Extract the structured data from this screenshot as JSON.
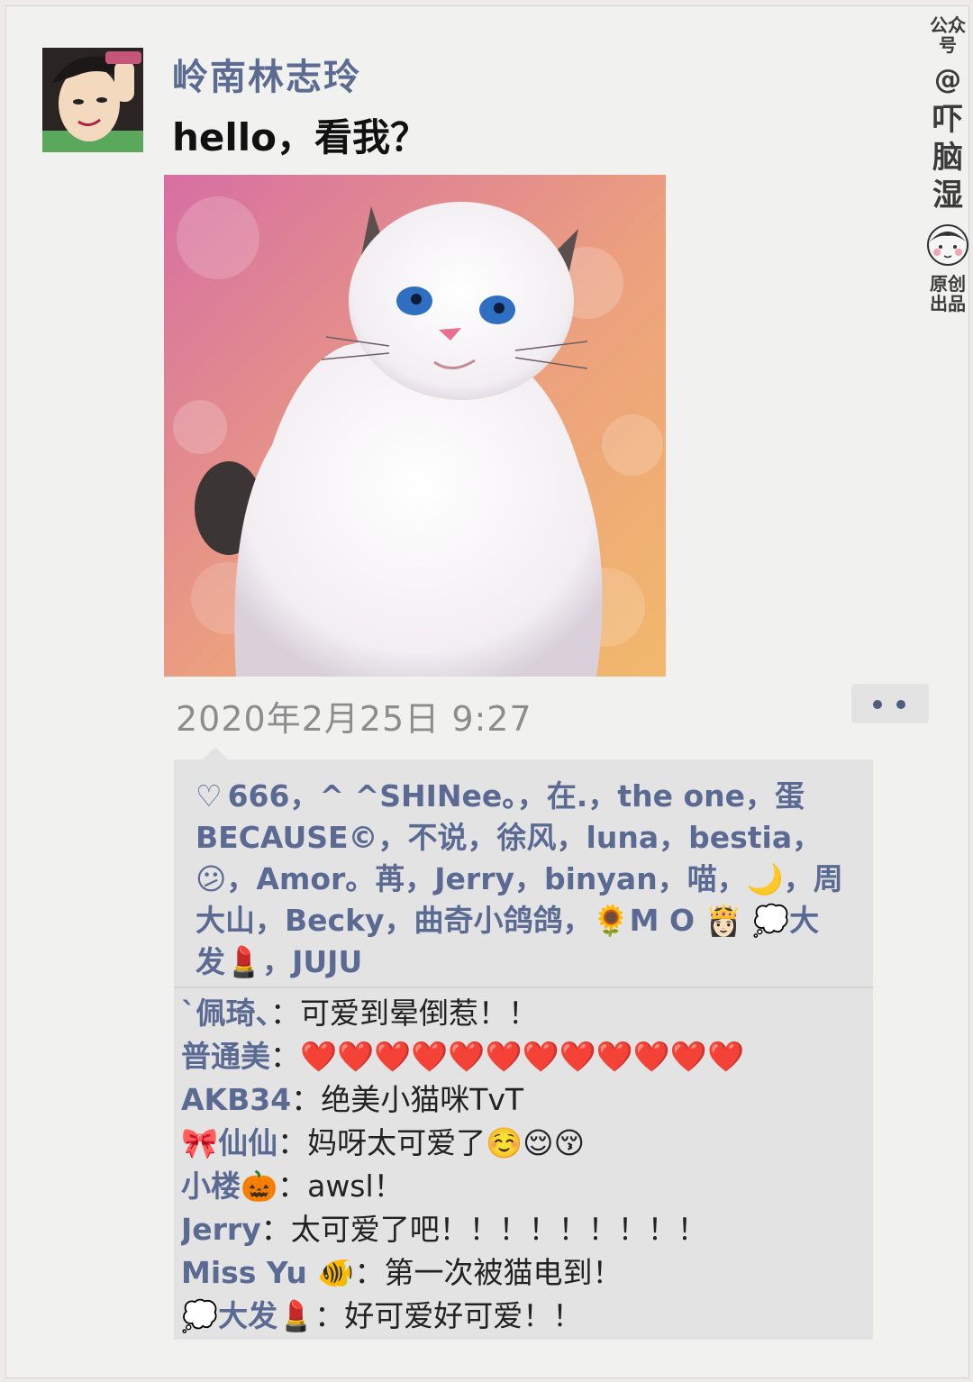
{
  "post": {
    "author": "岭南林志玲",
    "text": "hello，看我？",
    "timestamp": "2020年2月25日 9:27"
  },
  "likes": {
    "heart_icon": "heart-outline-icon",
    "text": "666，^ ^SHINee。，在.，the one，蛋BECAUSE©，不说，徐风，luna，bestia，😕，Amor。苒，Jerry，binyan，喵，🌙，周大山，Becky，曲奇小鸽鸽，🌻M O 👸🏻 💭大发💄，JUJU"
  },
  "comments": [
    {
      "name": "`佩琦、",
      "sep": "：",
      "text": "可爱到晕倒惹！！"
    },
    {
      "name": "普通美",
      "sep": "：",
      "text": "❤️❤️❤️❤️❤️❤️❤️❤️❤️❤️❤️❤️"
    },
    {
      "name": "AKB34",
      "sep": "：",
      "text": "绝美小猫咪TvT"
    },
    {
      "name": "🎀仙仙",
      "sep": "：",
      "text": "妈呀太可爱了☺️😌😚"
    },
    {
      "name": "小楼🎃",
      "sep": "：",
      "text": "awsl！"
    },
    {
      "name": "Jerry",
      "sep": "：",
      "text": "太可爱了吧！！！！！！！！！"
    },
    {
      "name": "Miss Yu 🐠",
      "sep": "：",
      "text": "第一次被猫电到！"
    },
    {
      "name": "💭大发💄",
      "sep": "：",
      "text": "好可爱好可爱！！"
    }
  ],
  "watermark": {
    "top": "公众号",
    "at": "@",
    "brand": [
      "吓",
      "脑",
      "湿"
    ],
    "bottom": "原创出品"
  }
}
